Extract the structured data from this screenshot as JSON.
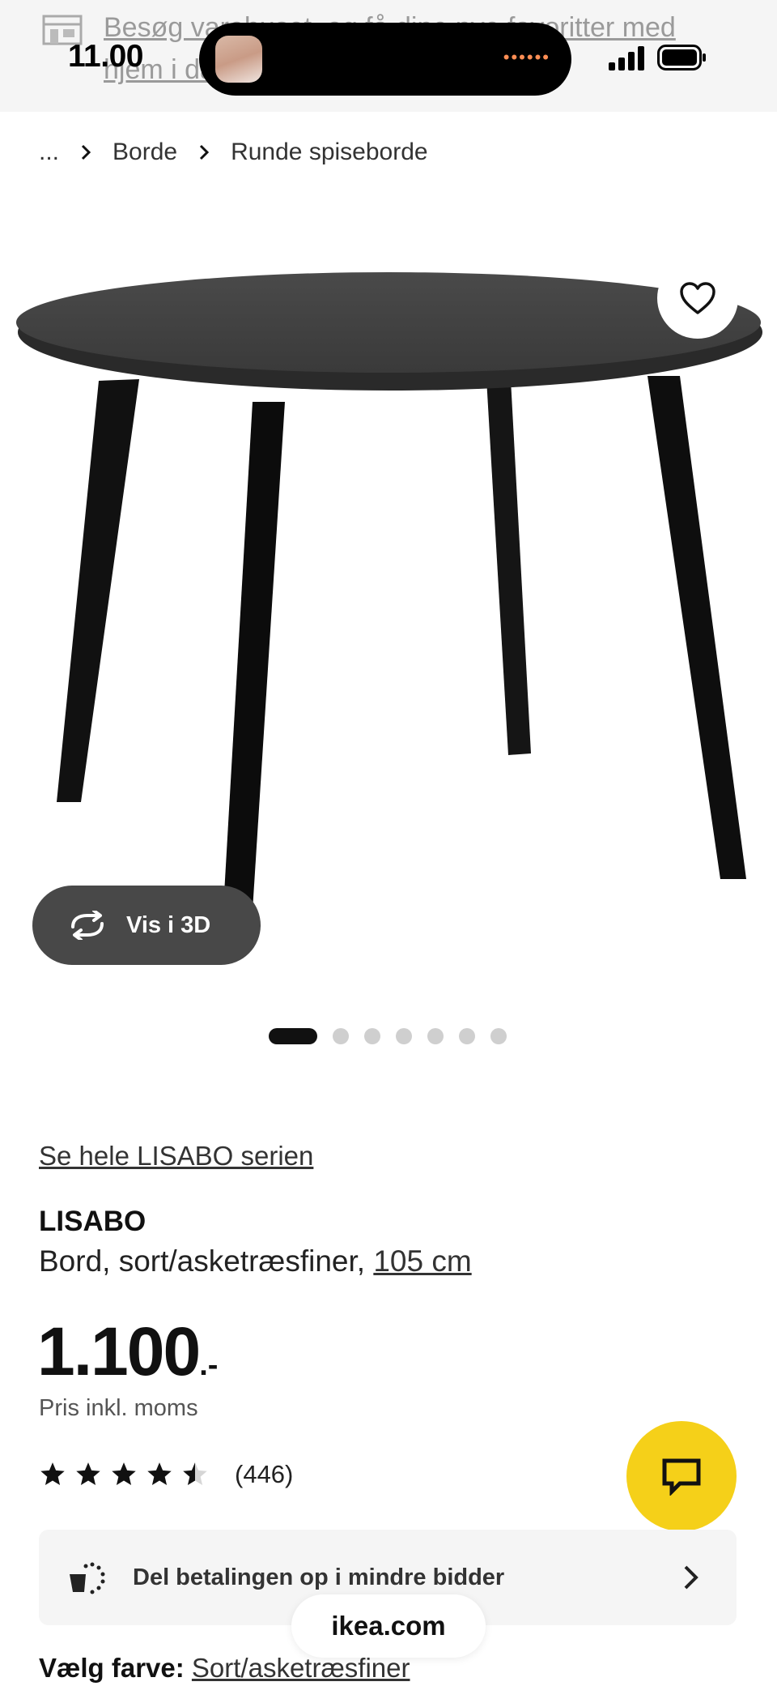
{
  "banner": {
    "text": "Besøg varehuset, og få dine nye favoritter med hjem i dag",
    "icon": "store-icon"
  },
  "status_bar": {
    "time": "11.00",
    "icons": [
      "signal-icon",
      "battery-icon"
    ]
  },
  "breadcrumb": {
    "items": [
      "...",
      "Borde",
      "Runde spiseborde"
    ]
  },
  "gallery": {
    "view_3d_label": "Vis i 3D",
    "dot_count": 7,
    "active_index": 0
  },
  "product": {
    "series_link": "Se hele LISABO serien",
    "name": "LISABO",
    "description": "Bord, sort/asketræsfiner,",
    "size_link": "105 cm",
    "price": "1.100",
    "price_suffix": ".-",
    "price_note": "Pris inkl. moms",
    "rating_value": 4.5,
    "rating_count": "(446)"
  },
  "payment": {
    "label": "Del betalingen op i mindre bidder"
  },
  "browser": {
    "url": "ikea.com"
  },
  "color": {
    "label": "Vælg farve:",
    "value": "Sort/asketræsfiner"
  },
  "colors": {
    "brand_yellow": "#f5d019",
    "button_dark": "#484848",
    "card_bg": "#f5f5f5"
  }
}
